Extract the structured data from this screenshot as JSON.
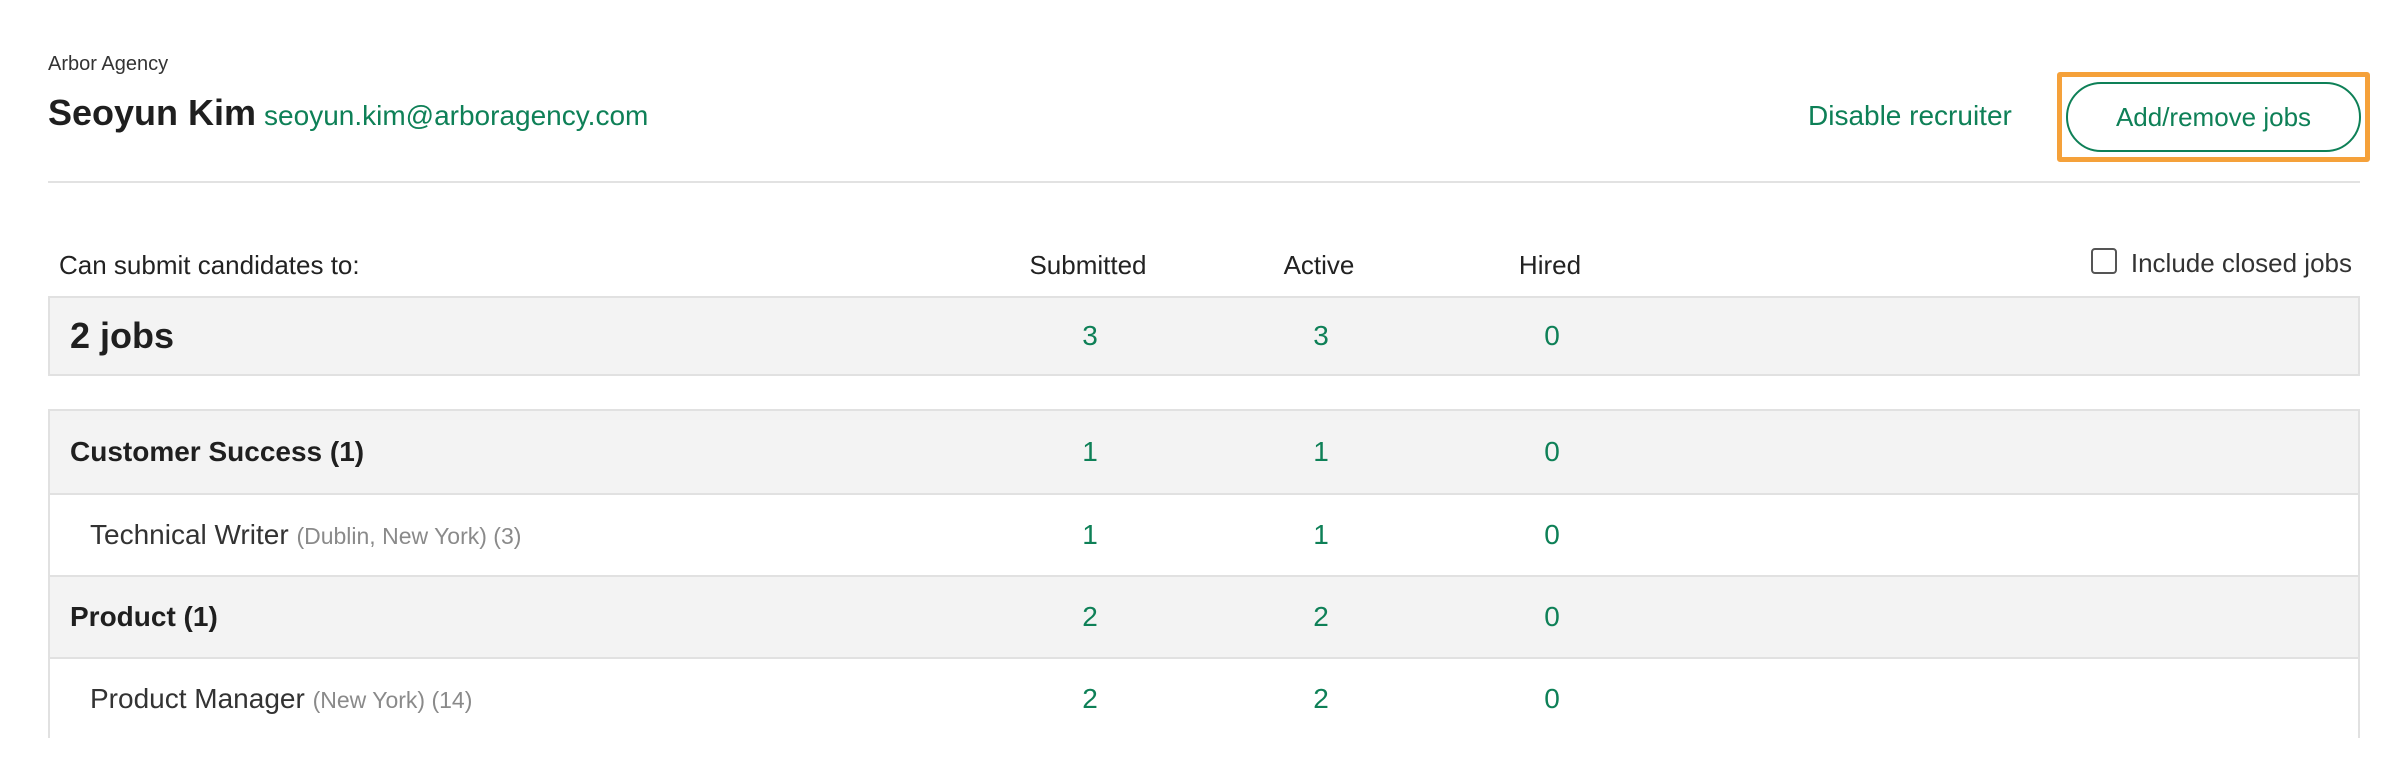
{
  "header": {
    "agency": "Arbor Agency",
    "name": "Seoyun Kim",
    "email": "seoyun.kim@arboragency.com",
    "disable_label": "Disable recruiter",
    "add_remove_label": "Add/remove jobs"
  },
  "table_header": {
    "title": "Can submit candidates to:",
    "submitted": "Submitted",
    "active": "Active",
    "hired": "Hired",
    "include_closed_label": "Include closed jobs",
    "include_closed_checked": false
  },
  "summary": {
    "title": "2 jobs",
    "submitted": "3",
    "active": "3",
    "hired": "0"
  },
  "groups": [
    {
      "name": "Customer Success (1)",
      "submitted": "1",
      "active": "1",
      "hired": "0",
      "job": {
        "title": "Technical Writer",
        "meta": "(Dublin, New York) (3)",
        "submitted": "1",
        "active": "1",
        "hired": "0"
      }
    },
    {
      "name": "Product (1)",
      "submitted": "2",
      "active": "2",
      "hired": "0",
      "job": {
        "title": "Product Manager",
        "meta": "(New York) (14)",
        "submitted": "2",
        "active": "2",
        "hired": "0"
      }
    }
  ],
  "colors": {
    "accent": "#0e8057",
    "focus": "#f5a13a",
    "row_shade": "#f3f3f3"
  }
}
